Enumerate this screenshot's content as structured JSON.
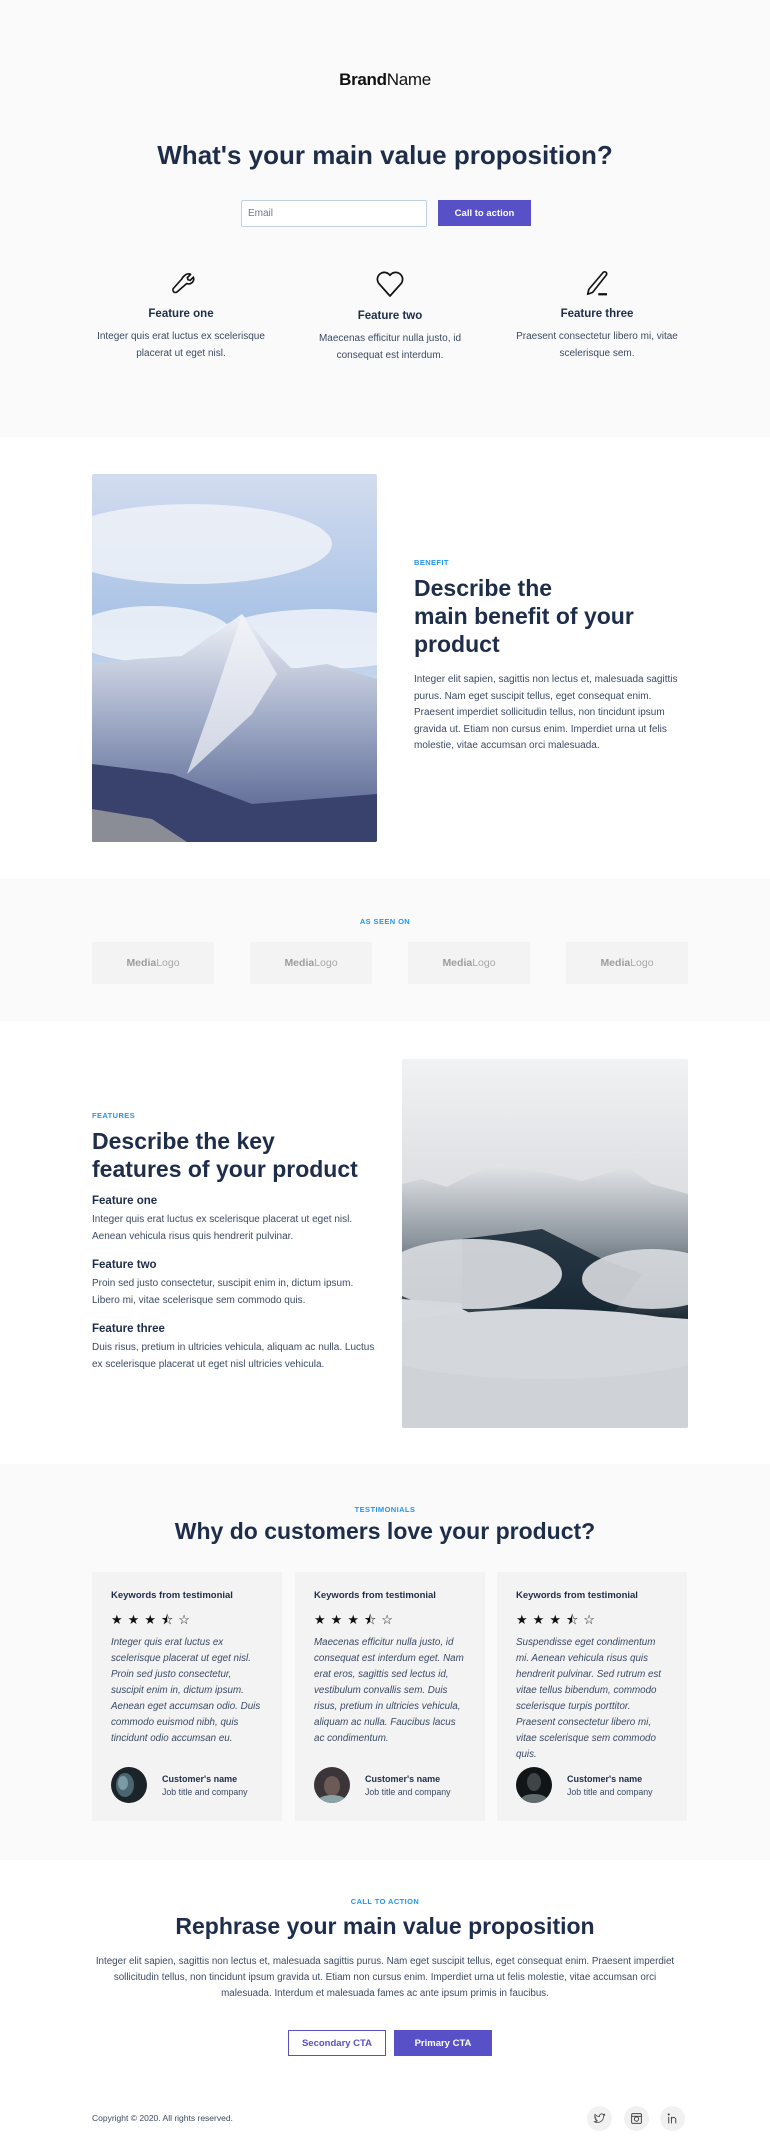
{
  "hero": {
    "brand_bold": "Brand",
    "brand_regular": "Name",
    "title": "What's your main value proposition?",
    "email_placeholder": "Email",
    "email_value": "",
    "cta_label": "Call to action",
    "features": [
      {
        "icon": "wrench-icon",
        "title": "Feature one",
        "text": "Integer quis erat luctus ex scelerisque placerat ut eget nisl."
      },
      {
        "icon": "heart-icon",
        "title": "Feature two",
        "text": "Maecenas efficitur nulla justo, id consequat est interdum."
      },
      {
        "icon": "pen-icon",
        "title": "Feature three",
        "text": "Praesent consectetur libero mi, vitae scelerisque sem."
      }
    ]
  },
  "benefit": {
    "eyebrow": "BENEFIT",
    "title_line1": "Describe the",
    "title_line2": "main benefit of your",
    "title_line3": "product",
    "body": "Integer elit sapien, sagittis non lectus et, malesuada sagittis purus. Nam eget suscipit tellus, eget consequat enim. Praesent imperdiet sollicitudin tellus, non tincidunt ipsum gravida ut. Etiam non cursus enim. Imperdiet urna ut felis molestie, vitae accumsan orci malesuada.",
    "image": "mountain-peak-photo"
  },
  "seen_on": {
    "label": "AS SEEN ON",
    "logos": [
      {
        "bold": "Media",
        "regular": "Logo"
      },
      {
        "bold": "Media",
        "regular": "Logo"
      },
      {
        "bold": "Media",
        "regular": "Logo"
      },
      {
        "bold": "Media",
        "regular": "Logo"
      }
    ]
  },
  "features": {
    "eyebrow": "FEATURES",
    "title_line1": "Describe the key",
    "title_line2": "features of your product",
    "items": [
      {
        "title": "Feature one",
        "text": "Integer quis erat luctus ex scelerisque placerat ut eget nisl. Aenean vehicula risus quis hendrerit pulvinar."
      },
      {
        "title": "Feature two",
        "text": "Proin sed justo consectetur, suscipit enim in, dictum ipsum. Libero mi, vitae scelerisque sem commodo quis."
      },
      {
        "title": "Feature three",
        "text": "Duis risus, pretium in ultricies vehicula, aliquam ac nulla. Luctus ex scelerisque placerat ut eget nisl ultricies vehicula."
      }
    ],
    "image": "misty-mountain-photo"
  },
  "testimonials": {
    "eyebrow": "TESTIMONIALS",
    "title": "Why do customers love your product?",
    "cards": [
      {
        "keywords": "Keywords from testimonial",
        "rating": 3.5,
        "rating_max": 5,
        "quote": "Integer quis erat luctus ex scelerisque placerat ut eget nisl. Proin sed justo consectetur, suscipit enim in, dictum ipsum. Aenean eget accumsan odio. Duis commodo euismod nibh, quis tincidunt odio accumsan eu.",
        "name": "Customer's name",
        "job": "Job title and company"
      },
      {
        "keywords": "Keywords from testimonial",
        "rating": 3.5,
        "rating_max": 5,
        "quote": "Maecenas efficitur nulla justo, id consequat est interdum eget. Nam erat eros, sagittis sed lectus id, vestibulum convallis sem. Duis risus, pretium in ultricies vehicula, aliquam ac nulla. Faucibus lacus ac condimentum.",
        "name": "Customer's name",
        "job": "Job title and company"
      },
      {
        "keywords": "Keywords from testimonial",
        "rating": 3.5,
        "rating_max": 5,
        "quote": "Suspendisse eget condimentum mi. Aenean vehicula risus quis hendrerit pulvinar. Sed rutrum est vitae tellus bibendum, commodo scelerisque turpis porttitor. Praesent consectetur libero mi, vitae scelerisque sem commodo quis.",
        "name": "Customer's name",
        "job": "Job title and company"
      }
    ]
  },
  "final_cta": {
    "eyebrow": "CALL TO ACTION",
    "title": "Rephrase your main value proposition",
    "body": "Integer elit sapien, sagittis non lectus et, malesuada sagittis purus. Nam eget suscipit tellus, eget consequat enim. Praesent imperdiet sollicitudin tellus, non tincidunt ipsum gravida ut. Etiam non cursus enim. Imperdiet urna ut felis molestie, vitae accumsan orci malesuada. Interdum et malesuada fames ac ante ipsum primis in faucibus.",
    "secondary_label": "Secondary CTA",
    "primary_label": "Primary CTA"
  },
  "footer": {
    "copyright": "Copyright © 2020. All rights reserved.",
    "social": [
      "twitter-icon",
      "instagram-icon",
      "linkedin-icon"
    ]
  },
  "colors": {
    "accent": "#5750c7",
    "eyebrow": "#2196f3",
    "heading": "#1e2d4a",
    "body_text": "#3b4a63",
    "section_gray": "#fafafa",
    "card_gray": "#f3f3f3"
  }
}
